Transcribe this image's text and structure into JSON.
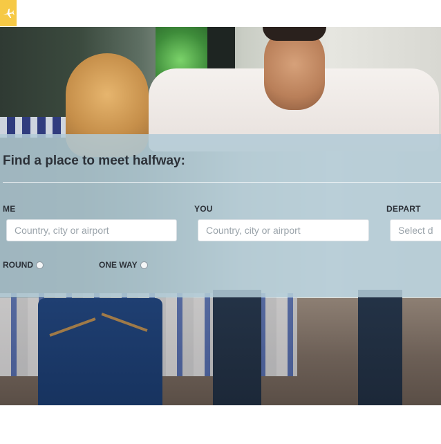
{
  "logo": {
    "icon": "airplane-icon",
    "color": "#f6c945"
  },
  "hero": {
    "description_icon": "photo"
  },
  "search_panel": {
    "title": "Find a place to meet halfway:",
    "fields": [
      {
        "label": "ME",
        "placeholder": "Country, city or airport"
      },
      {
        "label": "YOU",
        "placeholder": "Country, city or airport"
      },
      {
        "label": "DEPART",
        "placeholder": "Select date"
      }
    ],
    "trip_types": [
      {
        "label": "ROUND"
      },
      {
        "label": "ONE WAY"
      }
    ]
  },
  "colors": {
    "panel": "#b2cbd6",
    "accent": "#f6c945",
    "text": "#2c3138"
  }
}
